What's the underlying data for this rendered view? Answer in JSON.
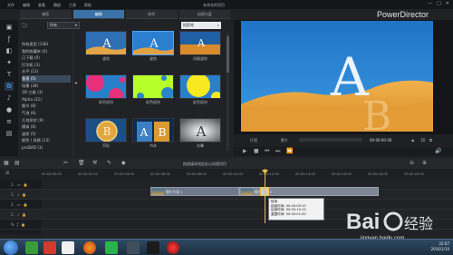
{
  "window": {
    "menu": [
      "文件",
      "编辑",
      "查看",
      "播放",
      "工具",
      "帮助"
    ],
    "project_title": "未命名的项目",
    "brand": "PowerDirector",
    "controls": [
      "—",
      "□",
      "✕"
    ]
  },
  "mode_tabs": [
    {
      "label": "捕获"
    },
    {
      "label": "编辑"
    },
    {
      "label": "制作"
    },
    {
      "label": "创建光盘"
    }
  ],
  "filter": {
    "selected": "所有",
    "search_placeholder": "搜索库"
  },
  "categories": [
    {
      "label": "所有类型 (136)"
    },
    {
      "label": "我的收藏夹 (0)"
    },
    {
      "label": "已下载 (0)"
    },
    {
      "label": "打字机 (3)"
    },
    {
      "label": "水平 (12)"
    },
    {
      "label": "垂直 (5)"
    },
    {
      "label": "场景 (38)"
    },
    {
      "label": "3D-三维 (3)"
    },
    {
      "label": "Alpha (22)"
    },
    {
      "label": "细节 (8)"
    },
    {
      "label": "气泡 (6)"
    },
    {
      "label": "几何形状 (9)"
    },
    {
      "label": "模拟 (6)"
    },
    {
      "label": "波纹 (5)"
    },
    {
      "label": "颜色 / 风格 (13)"
    },
    {
      "label": "proDAD (1)"
    }
  ],
  "templates": [
    {
      "label": "波纹",
      "style": "desert"
    },
    {
      "label": "波纹",
      "style": "desert-selected"
    },
    {
      "label": "风格波纹",
      "style": "sunset"
    },
    {
      "label": "彩色斑块",
      "style": "blob-magenta"
    },
    {
      "label": "彩色斑块",
      "style": "blob-lime"
    },
    {
      "label": "彩色斑块",
      "style": "blob-yellow"
    },
    {
      "label": "币形",
      "style": "coin"
    },
    {
      "label": "书本",
      "style": "book"
    },
    {
      "label": "光晕",
      "style": "glow"
    }
  ],
  "preview": {
    "mode_buttons": [
      "片段",
      "影片"
    ],
    "timecode": "00:00:00:00",
    "view_3d": "3D"
  },
  "timeline": {
    "hint": "拖放媒体到此处以创建项目",
    "ruler": [
      "00:00:00:00",
      "00:00:02:00",
      "00:00:04:00",
      "00:00:06:00",
      "00:00:08:00",
      "00:00:10:00",
      "00:00:12:00",
      "00:00:14:00",
      "00:00:16:00",
      "00:00:18:00",
      "00:00:20:00"
    ],
    "tracks": [
      {
        "label": "1.",
        "kind": "video"
      },
      {
        "label": "1.",
        "kind": "audio"
      },
      {
        "label": "2.",
        "kind": "video"
      },
      {
        "label": "2.",
        "kind": "audio"
      },
      {
        "label": "fx",
        "kind": "effect"
      }
    ],
    "clips": [
      {
        "label": "图片片段 1"
      },
      {
        "label": "图片片段 2"
      }
    ],
    "tooltip": {
      "title": "转场",
      "lines": [
        "起始时间: 00:00:09:15",
        "结束时间: 00:00:10:15",
        "重叠时间: 00:00:01:00"
      ]
    }
  },
  "watermark": {
    "brand": "Bai◎ 经验",
    "url": "jingyan.baidu.com"
  },
  "taskbar": {
    "time": "22:07",
    "date": "2016/1/10"
  }
}
